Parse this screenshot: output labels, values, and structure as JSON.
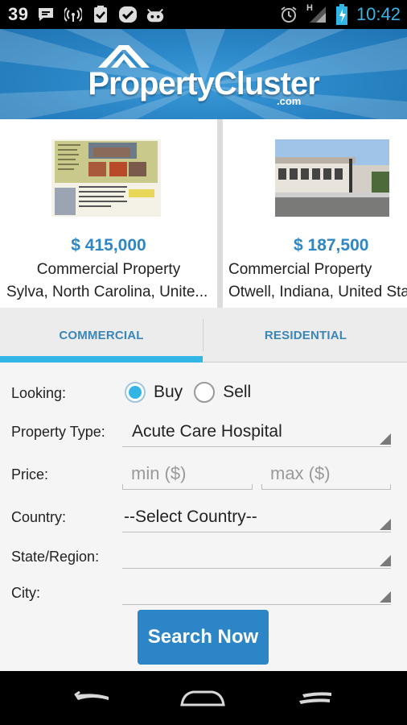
{
  "status_bar": {
    "left_number": "39",
    "time": "10:42",
    "left_icons": [
      "chat-icon",
      "wireless-icon",
      "clipboard-check-icon",
      "check-badge-icon",
      "robot-icon"
    ],
    "right_icons": [
      "alarm-icon",
      "signal-icon",
      "battery-icon"
    ],
    "network_label": "H"
  },
  "header": {
    "logo_text": "PropertyCluster",
    "logo_suffix": ".com",
    "brand_color": "#2b87c8"
  },
  "listings": [
    {
      "price": "$ 415,000",
      "type": "Commercial Property",
      "location": "Sylva, North Carolina, Unite...",
      "thumb_icon": "flyer-image"
    },
    {
      "price": "$ 187,500",
      "type": "Commercial Property",
      "location": "Otwell, Indiana, United Sta",
      "thumb_icon": "building-photo"
    }
  ],
  "tabs": [
    {
      "label": "COMMERCIAL",
      "active": true
    },
    {
      "label": "RESIDENTIAL",
      "active": false
    }
  ],
  "form": {
    "looking_label": "Looking:",
    "radio_options": [
      {
        "label": "Buy",
        "checked": true
      },
      {
        "label": "Sell",
        "checked": false
      }
    ],
    "property_type_label": "Property Type:",
    "property_type_value": "Acute Care Hospital",
    "price_label": "Price:",
    "price_min_placeholder": "min ($)",
    "price_max_placeholder": "max ($)",
    "country_label": "Country:",
    "country_value": "--Select Country--",
    "state_label": "State/Region:",
    "state_value": "",
    "city_label": "City:",
    "city_value": "",
    "search_button": "Search Now"
  },
  "colors": {
    "accent": "#33b5e5",
    "price": "#2e86c4",
    "tab_text": "#3a86b8",
    "button": "#2b85c6"
  },
  "nav_bar": {
    "buttons": [
      "back-icon",
      "home-icon",
      "recent-apps-icon"
    ]
  }
}
